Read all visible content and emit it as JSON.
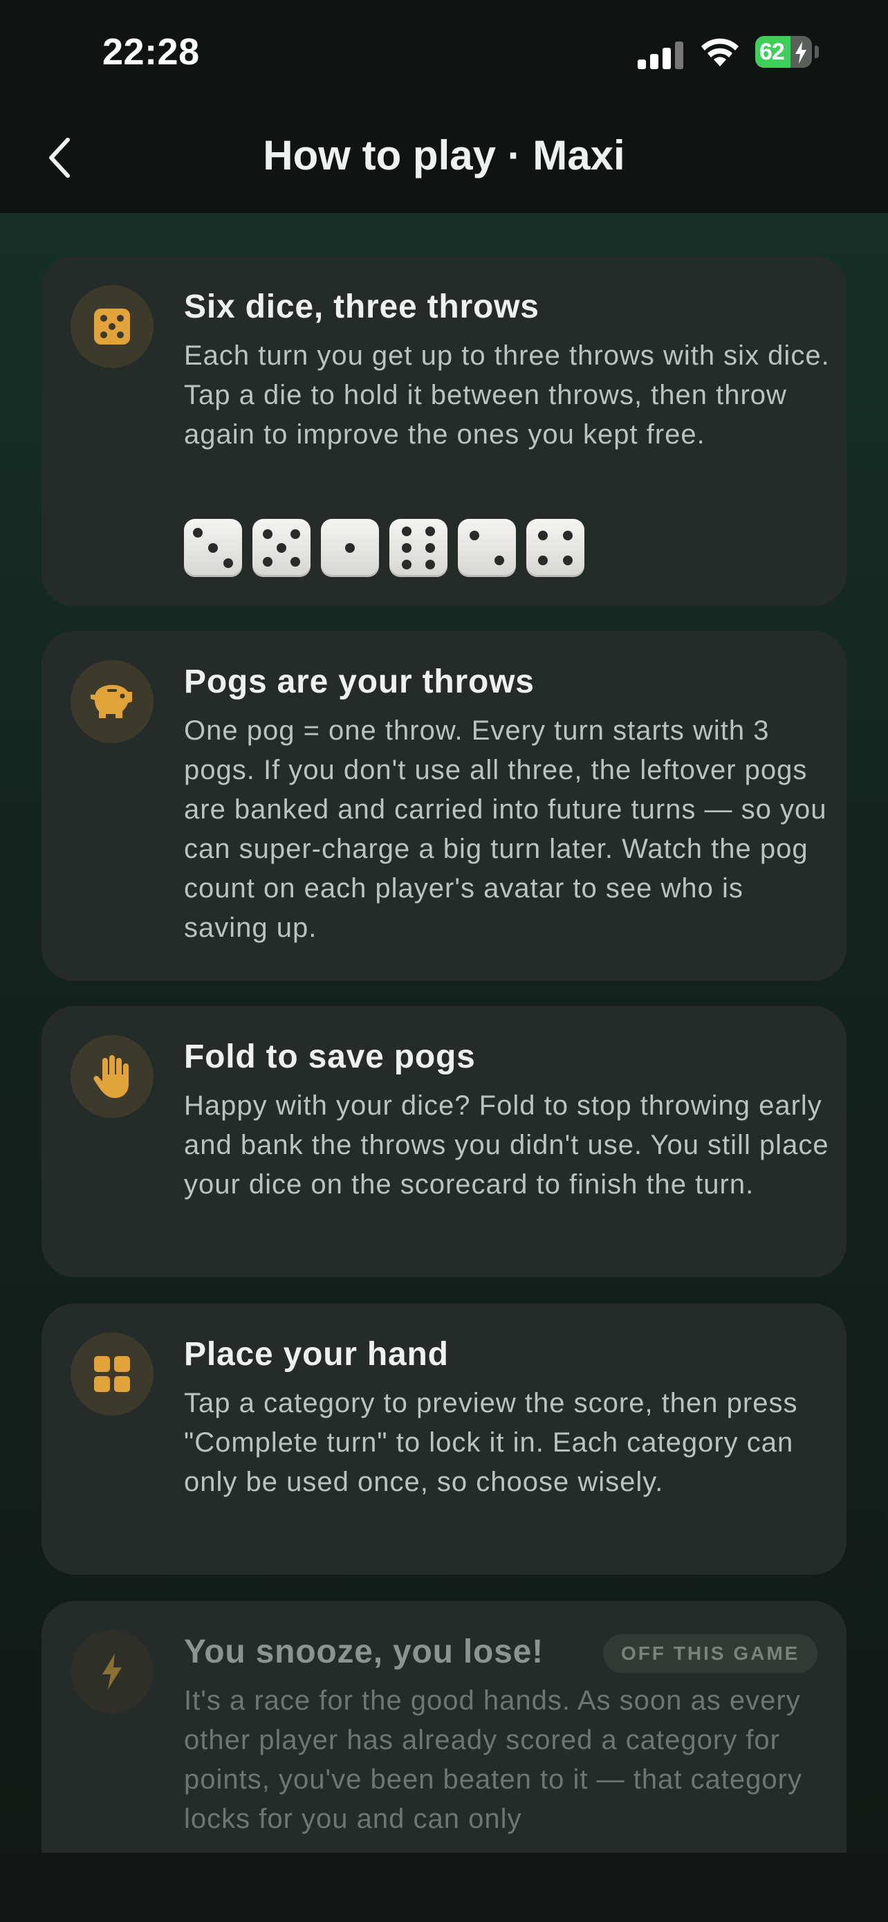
{
  "status_bar": {
    "time": "22:28",
    "battery_percent": "62",
    "battery_level": 0.62
  },
  "nav": {
    "title": "How to play · Maxi"
  },
  "cards": [
    {
      "title": "Six dice, three throws",
      "body": "Each turn you get up to three throws with six dice. Tap a die to hold it between throws, then throw again to improve the ones you kept free.",
      "icon": "die-icon",
      "dice": [
        3,
        5,
        1,
        6,
        2,
        4
      ]
    },
    {
      "title": "Pogs are your throws",
      "body": "One pog = one throw. Every turn starts with 3 pogs. If you don't use all three, the leftover pogs are banked and carried into future turns — so you can super-charge a big turn later. Watch the pog count on each player's avatar to see who is saving up.",
      "icon": "piggy-bank-icon"
    },
    {
      "title": "Fold to save pogs",
      "body": "Happy with your dice? Fold to stop throwing early and bank the throws you didn't use. You still place your dice on the scorecard to finish the turn.",
      "icon": "hand-icon"
    },
    {
      "title": "Place your hand",
      "body": "Tap a category to preview the score, then press \"Complete turn\" to lock it in. Each category can only be used once, so choose wisely.",
      "icon": "grid-icon"
    },
    {
      "title": "You snooze, you lose!",
      "badge": "OFF THIS GAME",
      "body": "It's a race for the good hands. As soon as every other player has already scored a category for points, you've been beaten to it — that category locks for you and can only",
      "icon": "lightning-icon"
    }
  ],
  "colors": {
    "accent": "#e2a43a",
    "card": "#252b28",
    "background": "#121715"
  }
}
